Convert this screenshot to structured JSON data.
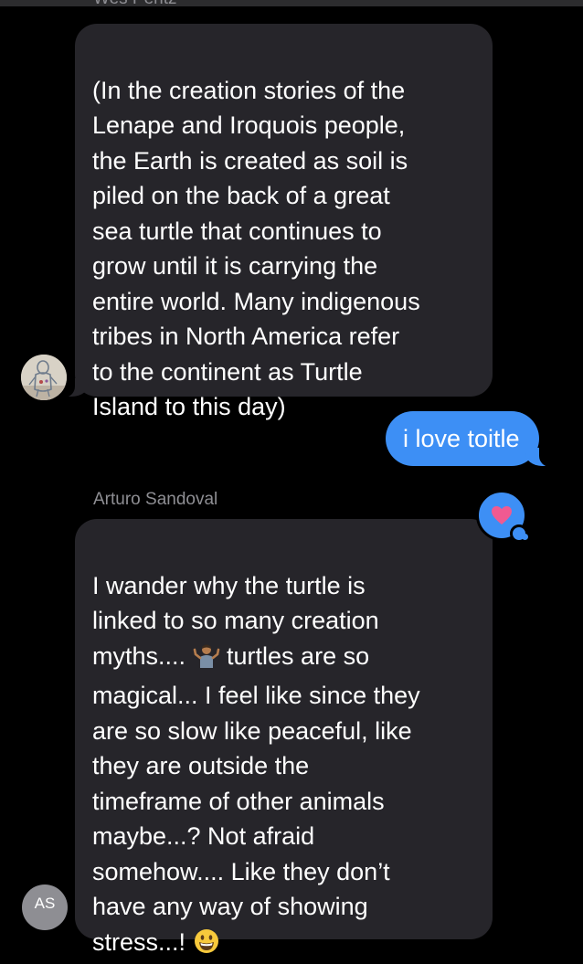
{
  "colors": {
    "incoming_bubble": "#26252a",
    "outgoing_bubble": "#3d8ff5",
    "sender_name": "#8e8e93",
    "tapback_heart": "#f05a91"
  },
  "thread": {
    "top_sender_name": "Wes Pentz",
    "message_1": {
      "text": "(In the creation stories of the\nLenape and Iroquois people,\nthe Earth is created as soil is\npiled on the back of a great\nsea turtle that continues to\ngrow until it is carrying the\nentire world. Many indigenous\ntribes in North America refer\nto the continent as Turtle\nIsland to this day)"
    },
    "message_2": {
      "text": "i love toitle"
    },
    "second_sender_name": "Arturo Sandoval",
    "tapback_icon": "heart-icon",
    "message_3": {
      "part_1": "I wander why the turtle is\nlinked to so many creation\nmyths.... ",
      "emoji_1": "person-shrugging-emoji",
      "part_2": " turtles are so\nmagical... I feel like since they\nare so slow like peaceful, like\nthey are outside the\ntimeframe of other animals\nmaybe...? Not afraid\nsomehow.... Like they don’t\nhave any way of showing\nstress...! ",
      "emoji_2": "grinning-face-emoji"
    },
    "avatar_2_initials": "AS"
  }
}
